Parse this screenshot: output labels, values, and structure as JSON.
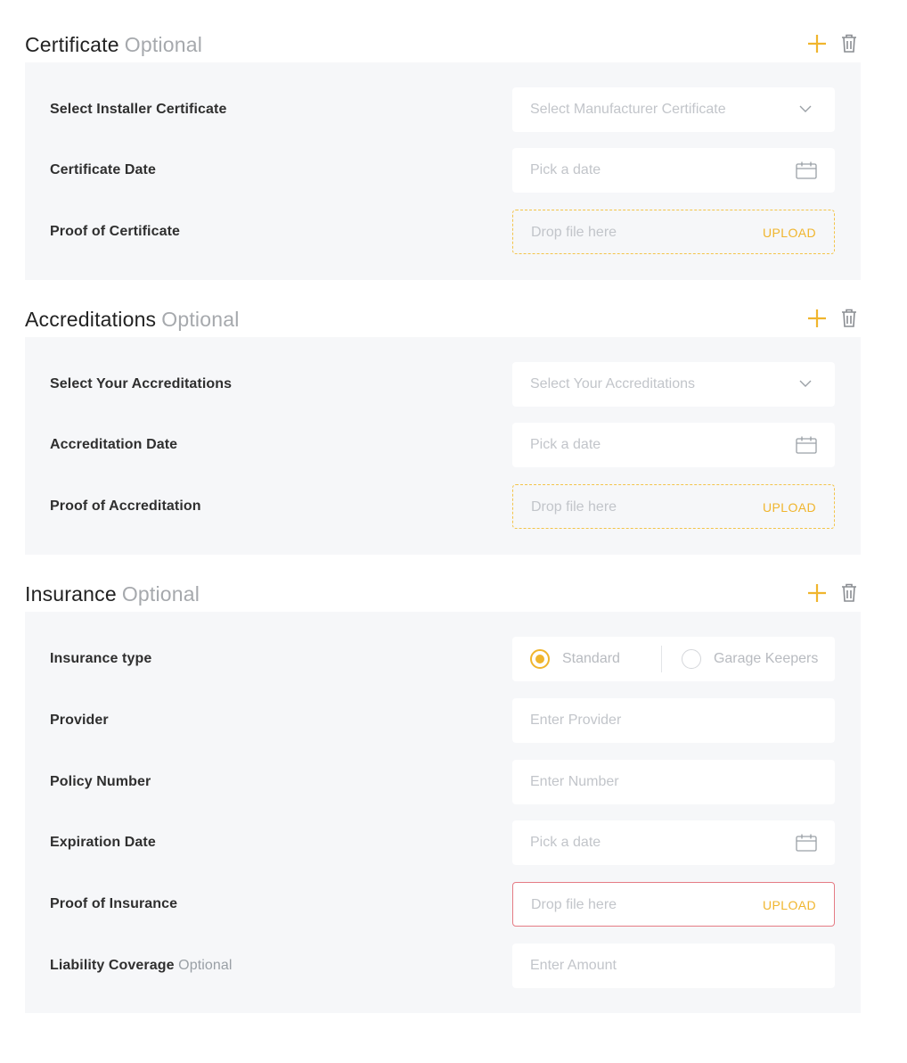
{
  "certificate": {
    "title": "Certificate",
    "optional": "Optional",
    "fields": {
      "installer_label": "Select Installer Certificate",
      "installer_placeholder": "Select Manufacturer Certificate",
      "date_label": "Certificate Date",
      "date_placeholder": "Pick a date",
      "proof_label": "Proof of Certificate",
      "proof_placeholder": "Drop file here",
      "upload_label": "UPLOAD"
    }
  },
  "accreditations": {
    "title": "Accreditations",
    "optional": "Optional",
    "fields": {
      "select_label": "Select Your Accreditations",
      "select_placeholder": "Select Your Accreditations",
      "date_label": "Accreditation Date",
      "date_placeholder": "Pick a date",
      "proof_label": "Proof of Accreditation",
      "proof_placeholder": "Drop file here",
      "upload_label": "UPLOAD"
    }
  },
  "insurance": {
    "title": "Insurance",
    "optional": "Optional",
    "fields": {
      "type_label": "Insurance type",
      "type_options": [
        "Standard",
        "Garage Keepers"
      ],
      "type_selected": "Standard",
      "provider_label": "Provider",
      "provider_placeholder": "Enter Provider",
      "policy_label": "Policy Number",
      "policy_placeholder": "Enter Number",
      "expiration_label": "Expiration Date",
      "expiration_placeholder": "Pick a date",
      "proof_label": "Proof of Insurance",
      "proof_placeholder": "Drop file here",
      "upload_label": "UPLOAD",
      "liability_label": "Liability Coverage",
      "liability_optional": "Optional",
      "liability_placeholder": "Enter Amount"
    }
  },
  "colors": {
    "accent": "#f0b52d",
    "panel_bg": "#f6f7f9",
    "error_border": "#e57b84",
    "muted_text": "#a6a9ad"
  },
  "icons": {
    "add": "plus-icon",
    "delete": "trash-icon",
    "calendar": "calendar-icon",
    "dropdown": "chevron-down-icon"
  }
}
